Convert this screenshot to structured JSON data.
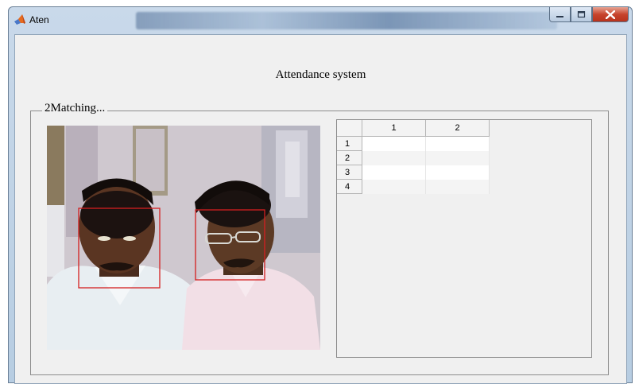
{
  "window": {
    "title": "Aten"
  },
  "heading": "Attendance system",
  "panel": {
    "title": "2Matching..."
  },
  "table": {
    "columns": [
      "1",
      "2"
    ],
    "rows": [
      {
        "label": "1",
        "cells": [
          "",
          ""
        ]
      },
      {
        "label": "2",
        "cells": [
          "",
          ""
        ]
      },
      {
        "label": "3",
        "cells": [
          "",
          ""
        ]
      },
      {
        "label": "4",
        "cells": [
          "",
          ""
        ]
      }
    ]
  },
  "camera": {
    "detections": 2,
    "box_color": "#d42020"
  },
  "colors": {
    "window_bg": "#f0f0f0",
    "close_button": "#c7442d",
    "titlebar": "#c9d9ea"
  },
  "icons": [
    "matlab-icon",
    "minimize-icon",
    "maximize-icon",
    "close-icon"
  ]
}
